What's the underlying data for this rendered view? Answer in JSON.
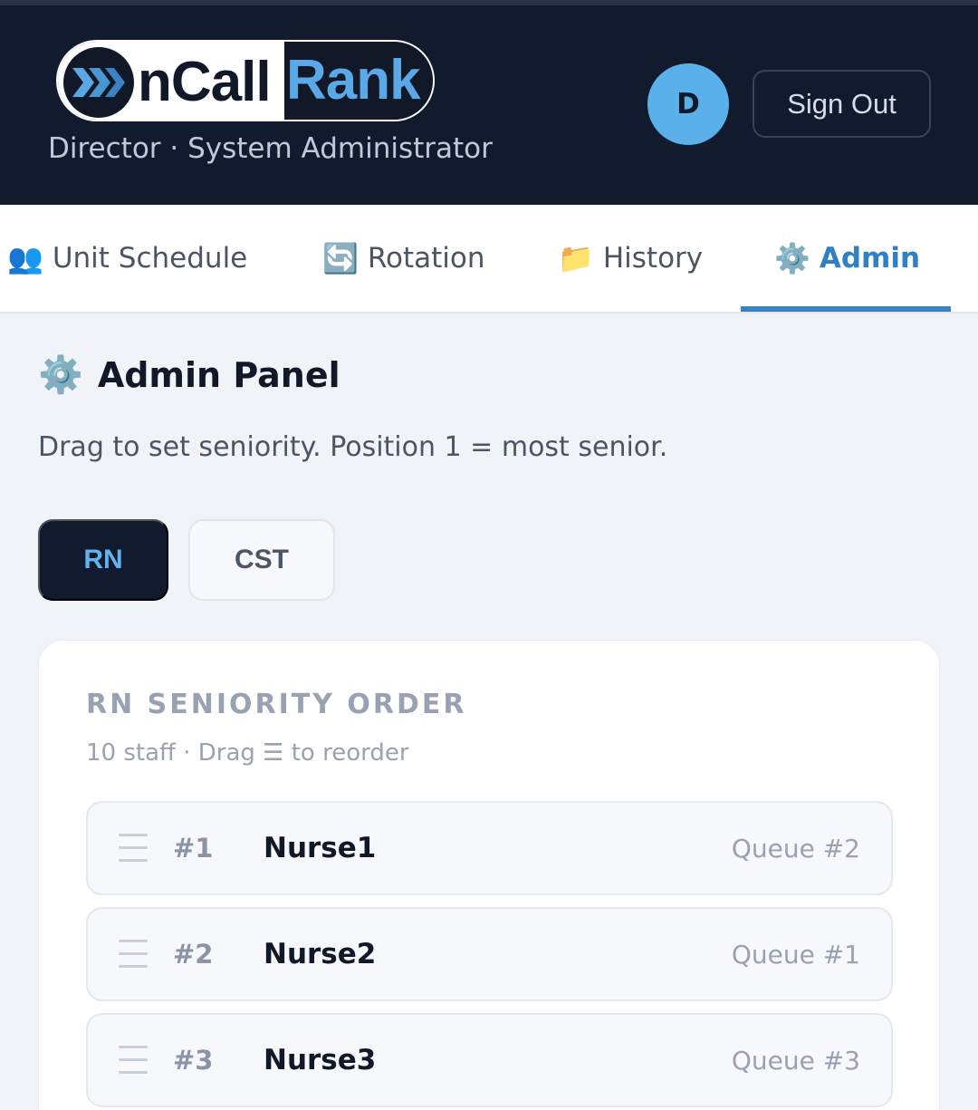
{
  "header": {
    "logo_left": "nCall",
    "logo_right": "Rank",
    "role": "Director · System Administrator",
    "avatar_initial": "D",
    "sign_out_label": "Sign Out",
    "colors": {
      "background": "#121a2e",
      "accent": "#5ab1ea"
    }
  },
  "tabs": [
    {
      "icon": "👥",
      "icon_name": "people-icon",
      "label": "Unit Schedule",
      "active": false
    },
    {
      "icon": "🔄",
      "icon_name": "refresh-icon",
      "label": "Rotation",
      "active": false
    },
    {
      "icon": "📁",
      "icon_name": "folder-icon",
      "label": "History",
      "active": false
    },
    {
      "icon": "⚙️",
      "icon_name": "gear-icon",
      "label": "Admin",
      "active": true
    }
  ],
  "panel": {
    "icon": "⚙️",
    "title": "Admin Panel",
    "description": "Drag to set seniority. Position 1 = most senior."
  },
  "segments": {
    "rn": "RN",
    "cst": "CST",
    "selected": "RN"
  },
  "seniority": {
    "title": "RN SENIORITY ORDER",
    "subtitle": "10 staff · Drag ☰ to reorder",
    "rows": [
      {
        "position": "#1",
        "name": "Nurse1",
        "queue": "Queue #2"
      },
      {
        "position": "#2",
        "name": "Nurse2",
        "queue": "Queue #1"
      },
      {
        "position": "#3",
        "name": "Nurse3",
        "queue": "Queue #3"
      }
    ]
  }
}
